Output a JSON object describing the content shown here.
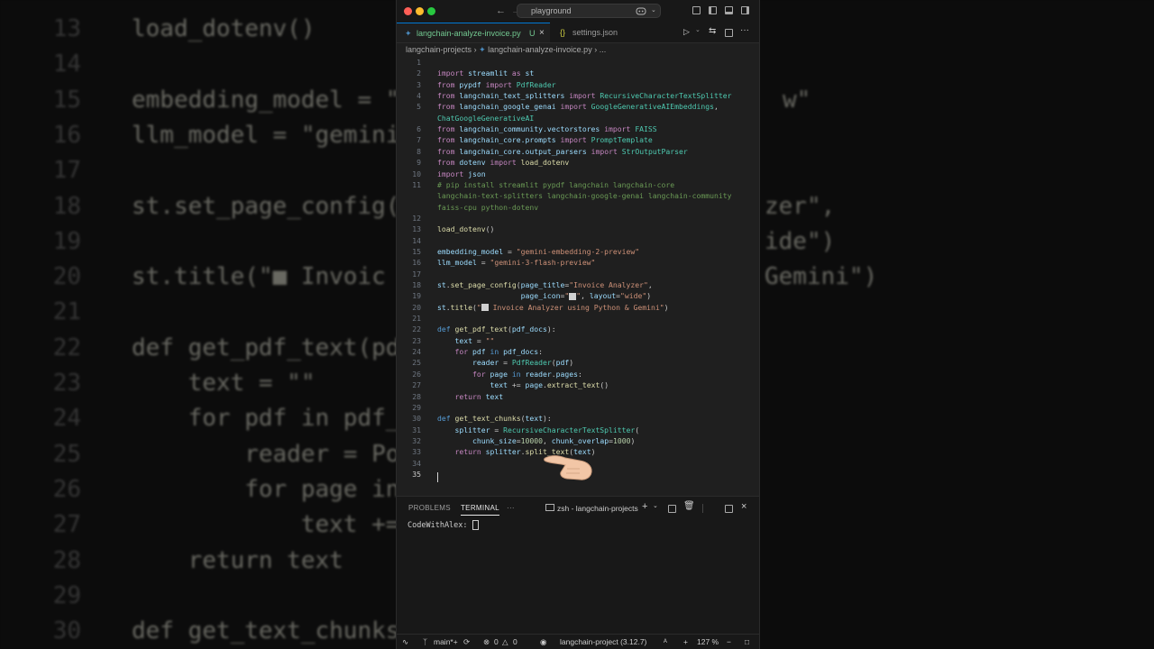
{
  "background": {
    "lines": [
      {
        "num": "13",
        "code": "load_dotenv()"
      },
      {
        "num": "14",
        "code": ""
      },
      {
        "num": "15",
        "code": "embedding_model = \""
      },
      {
        "num": "16",
        "code": "llm_model = \"gemini"
      },
      {
        "num": "17",
        "code": ""
      },
      {
        "num": "18",
        "code": "st.set_page_config("
      },
      {
        "num": "19",
        "code": ""
      },
      {
        "num": "20",
        "code": "st.title(\"■ Invoic"
      },
      {
        "num": "21",
        "code": ""
      },
      {
        "num": "22",
        "code": "def get_pdf_text(pd"
      },
      {
        "num": "23",
        "code": "    text = \"\""
      },
      {
        "num": "24",
        "code": "    for pdf in pdf_"
      },
      {
        "num": "25",
        "code": "        reader = Po"
      },
      {
        "num": "26",
        "code": "        for page in"
      },
      {
        "num": "27",
        "code": "            text +="
      },
      {
        "num": "28",
        "code": "    return text"
      },
      {
        "num": "29",
        "code": ""
      },
      {
        "num": "30",
        "code": "def get_text_chunks"
      }
    ],
    "right_fragments": [
      {
        "row": 2,
        "text": "w\""
      },
      {
        "row": 5,
        "text": "zer\","
      },
      {
        "row": 6,
        "text": "ide\")"
      },
      {
        "row": 7,
        "text": "Gemini\")"
      }
    ]
  },
  "titlebar": {
    "search_text": "playground",
    "colors": {
      "close": "#ff5f57",
      "minimize": "#febc2e",
      "maximize": "#28c840"
    }
  },
  "tabs": [
    {
      "label": "langchain-analyze-invoice.py",
      "status": "U",
      "active": true
    },
    {
      "label": "settings.json",
      "prefix": "{}",
      "active": false
    }
  ],
  "breadcrumb": {
    "folder": "langchain-projects",
    "file": "langchain-analyze-invoice.py",
    "tail": "..."
  },
  "editor": {
    "current_line": "35",
    "lines": [
      {
        "n": "1",
        "t": []
      },
      {
        "n": "2",
        "t": [
          [
            "k",
            "import"
          ],
          [
            "p",
            " "
          ],
          [
            "v",
            "streamlit"
          ],
          [
            "p",
            " "
          ],
          [
            "k",
            "as"
          ],
          [
            "p",
            " "
          ],
          [
            "v",
            "st"
          ]
        ]
      },
      {
        "n": "3",
        "t": [
          [
            "k",
            "from"
          ],
          [
            "p",
            " "
          ],
          [
            "v",
            "pypdf"
          ],
          [
            "p",
            " "
          ],
          [
            "k",
            "import"
          ],
          [
            "p",
            " "
          ],
          [
            "t",
            "PdfReader"
          ]
        ]
      },
      {
        "n": "4",
        "t": [
          [
            "k",
            "from"
          ],
          [
            "p",
            " "
          ],
          [
            "v",
            "langchain_text_splitters"
          ],
          [
            "p",
            " "
          ],
          [
            "k",
            "import"
          ],
          [
            "p",
            " "
          ],
          [
            "t",
            "RecursiveCharacterTextSplitter"
          ]
        ]
      },
      {
        "n": "5",
        "t": [
          [
            "k",
            "from"
          ],
          [
            "p",
            " "
          ],
          [
            "v",
            "langchain_google_genai"
          ],
          [
            "p",
            " "
          ],
          [
            "k",
            "import"
          ],
          [
            "p",
            " "
          ],
          [
            "t",
            "GoogleGenerativeAIEmbeddings"
          ],
          [
            "p",
            ","
          ]
        ]
      },
      {
        "n": "",
        "t": [
          [
            "t",
            "ChatGoogleGenerativeAI"
          ]
        ]
      },
      {
        "n": "6",
        "t": [
          [
            "k",
            "from"
          ],
          [
            "p",
            " "
          ],
          [
            "v",
            "langchain_community.vectorstores"
          ],
          [
            "p",
            " "
          ],
          [
            "k",
            "import"
          ],
          [
            "p",
            " "
          ],
          [
            "t",
            "FAISS"
          ]
        ]
      },
      {
        "n": "7",
        "t": [
          [
            "k",
            "from"
          ],
          [
            "p",
            " "
          ],
          [
            "v",
            "langchain_core.prompts"
          ],
          [
            "p",
            " "
          ],
          [
            "k",
            "import"
          ],
          [
            "p",
            " "
          ],
          [
            "t",
            "PromptTemplate"
          ]
        ]
      },
      {
        "n": "8",
        "t": [
          [
            "k",
            "from"
          ],
          [
            "p",
            " "
          ],
          [
            "v",
            "langchain_core.output_parsers"
          ],
          [
            "p",
            " "
          ],
          [
            "k",
            "import"
          ],
          [
            "p",
            " "
          ],
          [
            "t",
            "StrOutputParser"
          ]
        ]
      },
      {
        "n": "9",
        "t": [
          [
            "k",
            "from"
          ],
          [
            "p",
            " "
          ],
          [
            "v",
            "dotenv"
          ],
          [
            "p",
            " "
          ],
          [
            "k",
            "import"
          ],
          [
            "p",
            " "
          ],
          [
            "f",
            "load_dotenv"
          ]
        ]
      },
      {
        "n": "10",
        "t": [
          [
            "k",
            "import"
          ],
          [
            "p",
            " "
          ],
          [
            "v",
            "json"
          ]
        ]
      },
      {
        "n": "11",
        "t": [
          [
            "c",
            "# pip install streamlit pypdf langchain langchain-core"
          ]
        ]
      },
      {
        "n": "",
        "t": [
          [
            "c",
            "langchain-text-splitters langchain-google-genai langchain-community"
          ]
        ]
      },
      {
        "n": "",
        "t": [
          [
            "c",
            "faiss-cpu python-dotenv"
          ]
        ]
      },
      {
        "n": "12",
        "t": []
      },
      {
        "n": "13",
        "t": [
          [
            "f",
            "load_dotenv"
          ],
          [
            "p",
            "()"
          ]
        ]
      },
      {
        "n": "14",
        "t": []
      },
      {
        "n": "15",
        "t": [
          [
            "v",
            "embedding_model"
          ],
          [
            "p",
            " = "
          ],
          [
            "s",
            "\"gemini-embedding-2-preview\""
          ]
        ]
      },
      {
        "n": "16",
        "t": [
          [
            "v",
            "llm_model"
          ],
          [
            "p",
            " = "
          ],
          [
            "s",
            "\"gemini-3-flash-preview\""
          ]
        ]
      },
      {
        "n": "17",
        "t": []
      },
      {
        "n": "18",
        "t": [
          [
            "v",
            "st"
          ],
          [
            "p",
            "."
          ],
          [
            "f",
            "set_page_config"
          ],
          [
            "p",
            "("
          ],
          [
            "v",
            "page_title"
          ],
          [
            "p",
            "="
          ],
          [
            "s",
            "\"Invoice Analyzer\""
          ],
          [
            "p",
            ","
          ]
        ]
      },
      {
        "n": "19",
        "t": [
          [
            "p",
            "                   "
          ],
          [
            "v",
            "page_icon"
          ],
          [
            "p",
            "="
          ],
          [
            "s",
            "\""
          ],
          [
            "e",
            ""
          ],
          [
            "s",
            "\""
          ],
          [
            "p",
            ", "
          ],
          [
            "v",
            "layout"
          ],
          [
            "p",
            "="
          ],
          [
            "s",
            "\"wide\""
          ],
          [
            "p",
            ")"
          ]
        ]
      },
      {
        "n": "20",
        "t": [
          [
            "v",
            "st"
          ],
          [
            "p",
            "."
          ],
          [
            "f",
            "title"
          ],
          [
            "p",
            "("
          ],
          [
            "s",
            "\""
          ],
          [
            "e",
            ""
          ],
          [
            "s",
            " Invoice Analyzer using Python & Gemini\""
          ],
          [
            "p",
            ")"
          ]
        ]
      },
      {
        "n": "21",
        "t": []
      },
      {
        "n": "22",
        "t": [
          [
            "kb",
            "def"
          ],
          [
            "p",
            " "
          ],
          [
            "f",
            "get_pdf_text"
          ],
          [
            "p",
            "("
          ],
          [
            "v",
            "pdf_docs"
          ],
          [
            "p",
            "):"
          ]
        ]
      },
      {
        "n": "23",
        "t": [
          [
            "p",
            "    "
          ],
          [
            "v",
            "text"
          ],
          [
            "p",
            " = "
          ],
          [
            "s",
            "\"\""
          ]
        ]
      },
      {
        "n": "24",
        "t": [
          [
            "p",
            "    "
          ],
          [
            "k",
            "for"
          ],
          [
            "p",
            " "
          ],
          [
            "v",
            "pdf"
          ],
          [
            "p",
            " "
          ],
          [
            "kb",
            "in"
          ],
          [
            "p",
            " "
          ],
          [
            "v",
            "pdf_docs"
          ],
          [
            "p",
            ":"
          ]
        ]
      },
      {
        "n": "25",
        "t": [
          [
            "p",
            "        "
          ],
          [
            "v",
            "reader"
          ],
          [
            "p",
            " = "
          ],
          [
            "t",
            "PdfReader"
          ],
          [
            "p",
            "("
          ],
          [
            "v",
            "pdf"
          ],
          [
            "p",
            ")"
          ]
        ]
      },
      {
        "n": "26",
        "t": [
          [
            "p",
            "        "
          ],
          [
            "k",
            "for"
          ],
          [
            "p",
            " "
          ],
          [
            "v",
            "page"
          ],
          [
            "p",
            " "
          ],
          [
            "kb",
            "in"
          ],
          [
            "p",
            " "
          ],
          [
            "v",
            "reader"
          ],
          [
            "p",
            "."
          ],
          [
            "v",
            "pages"
          ],
          [
            "p",
            ":"
          ]
        ]
      },
      {
        "n": "27",
        "t": [
          [
            "p",
            "            "
          ],
          [
            "v",
            "text"
          ],
          [
            "p",
            " += "
          ],
          [
            "v",
            "page"
          ],
          [
            "p",
            "."
          ],
          [
            "f",
            "extract_text"
          ],
          [
            "p",
            "()"
          ]
        ]
      },
      {
        "n": "28",
        "t": [
          [
            "p",
            "    "
          ],
          [
            "k",
            "return"
          ],
          [
            "p",
            " "
          ],
          [
            "v",
            "text"
          ]
        ]
      },
      {
        "n": "29",
        "t": []
      },
      {
        "n": "30",
        "t": [
          [
            "kb",
            "def"
          ],
          [
            "p",
            " "
          ],
          [
            "f",
            "get_text_chunks"
          ],
          [
            "p",
            "("
          ],
          [
            "v",
            "text"
          ],
          [
            "p",
            "):"
          ]
        ]
      },
      {
        "n": "31",
        "t": [
          [
            "p",
            "    "
          ],
          [
            "v",
            "splitter"
          ],
          [
            "p",
            " = "
          ],
          [
            "t",
            "RecursiveCharacterTextSplitter"
          ],
          [
            "p",
            "("
          ]
        ]
      },
      {
        "n": "32",
        "t": [
          [
            "p",
            "        "
          ],
          [
            "v",
            "chunk_size"
          ],
          [
            "p",
            "="
          ],
          [
            "n",
            "10000"
          ],
          [
            "p",
            ", "
          ],
          [
            "v",
            "chunk_overlap"
          ],
          [
            "p",
            "="
          ],
          [
            "n",
            "1000"
          ],
          [
            "p",
            ")"
          ]
        ]
      },
      {
        "n": "33",
        "t": [
          [
            "p",
            "    "
          ],
          [
            "k",
            "return"
          ],
          [
            "p",
            " "
          ],
          [
            "v",
            "splitter"
          ],
          [
            "p",
            "."
          ],
          [
            "f",
            "split_text"
          ],
          [
            "p",
            "("
          ],
          [
            "v",
            "text"
          ],
          [
            "p",
            ")"
          ]
        ]
      },
      {
        "n": "34",
        "t": []
      },
      {
        "n": "35",
        "t": []
      }
    ]
  },
  "panel": {
    "tabs": [
      "PROBLEMS",
      "TERMINAL",
      "···"
    ],
    "active_tab": "TERMINAL",
    "terminal_name": "zsh - langchain-projects",
    "terminal_prompt": "CodeWithAlex: "
  },
  "statusbar": {
    "branch": "main*+",
    "errors": "0",
    "warnings": "0",
    "interpreter": "langchain-project (3.12.7)",
    "zoom": "127 %"
  }
}
